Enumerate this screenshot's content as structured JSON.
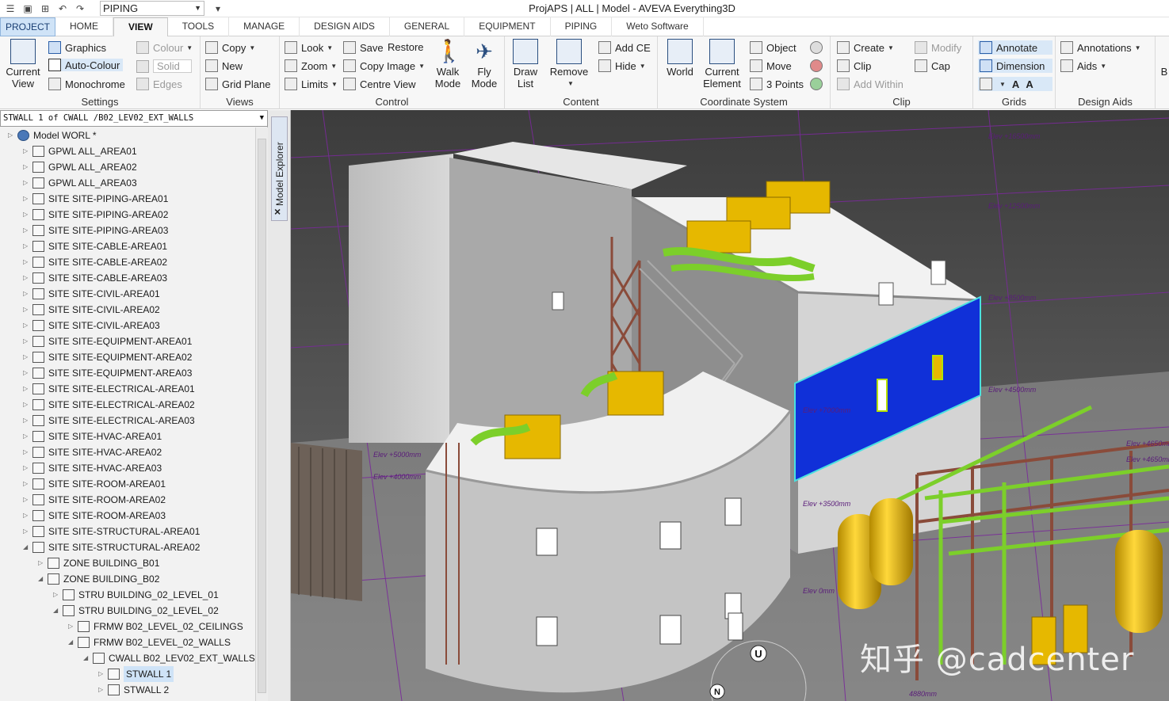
{
  "window": {
    "title": "ProjAPS | ALL | Model - AVEVA Everything3D"
  },
  "quick_access": {
    "module": "PIPING"
  },
  "tabs": [
    {
      "label": "PROJECT"
    },
    {
      "label": "HOME"
    },
    {
      "label": "VIEW"
    },
    {
      "label": "TOOLS"
    },
    {
      "label": "MANAGE"
    },
    {
      "label": "DESIGN AIDS"
    },
    {
      "label": "GENERAL"
    },
    {
      "label": "EQUIPMENT"
    },
    {
      "label": "PIPING"
    },
    {
      "label": "Weto Software"
    }
  ],
  "ribbon": {
    "settings": {
      "label": "Settings",
      "current_view": "Current View",
      "graphics": "Graphics",
      "auto_colour": "Auto-Colour",
      "monochrome": "Monochrome",
      "colour": "Colour",
      "solid": "Solid",
      "edges": "Edges"
    },
    "views": {
      "label": "Views",
      "copy": "Copy",
      "new": "New",
      "grid_plane": "Grid Plane"
    },
    "control": {
      "label": "Control",
      "look": "Look",
      "zoom": "Zoom",
      "limits": "Limits",
      "save": "Save",
      "restore": "Restore",
      "copy_image": "Copy Image",
      "centre_view": "Centre View",
      "walk_mode": "Walk Mode",
      "fly_mode": "Fly Mode"
    },
    "content": {
      "label": "Content",
      "draw_list": "Draw List",
      "remove": "Remove",
      "add_ce": "Add CE",
      "hide": "Hide"
    },
    "coordinate_system": {
      "label": "Coordinate System",
      "world": "World",
      "current_element": "Current Element",
      "object": "Object",
      "move": "Move",
      "three_points": "3 Points"
    },
    "clip": {
      "label": "Clip",
      "create": "Create",
      "clip": "Clip",
      "add_within": "Add Within",
      "modify": "Modify",
      "cap": "Cap"
    },
    "grids": {
      "label": "Grids",
      "annotate": "Annotate",
      "dimension": "Dimension"
    },
    "design_aids": {
      "label": "Design Aids",
      "annotations": "Annotations",
      "aids": "Aids",
      "more": "B"
    }
  },
  "explorer": {
    "breadcrumb": "STWALL 1 of CWALL /B02_LEV02_EXT_WALLS",
    "side_tab_label": "Model Explorer",
    "close_glyph": "×",
    "tree": [
      {
        "label": "Model WORL *",
        "level": 0,
        "icon": "globe-icon"
      },
      {
        "label": "GPWL ALL_AREA01",
        "level": 1,
        "icon": "group-icon"
      },
      {
        "label": "GPWL ALL_AREA02",
        "level": 1,
        "icon": "group-icon"
      },
      {
        "label": "GPWL ALL_AREA03",
        "level": 1,
        "icon": "group-icon"
      },
      {
        "label": "SITE SITE-PIPING-AREA01",
        "level": 1,
        "icon": "site-icon"
      },
      {
        "label": "SITE SITE-PIPING-AREA02",
        "level": 1,
        "icon": "site-icon"
      },
      {
        "label": "SITE SITE-PIPING-AREA03",
        "level": 1,
        "icon": "site-icon"
      },
      {
        "label": "SITE SITE-CABLE-AREA01",
        "level": 1,
        "icon": "site-icon"
      },
      {
        "label": "SITE SITE-CABLE-AREA02",
        "level": 1,
        "icon": "site-icon"
      },
      {
        "label": "SITE SITE-CABLE-AREA03",
        "level": 1,
        "icon": "site-icon"
      },
      {
        "label": "SITE SITE-CIVIL-AREA01",
        "level": 1,
        "icon": "site-icon"
      },
      {
        "label": "SITE SITE-CIVIL-AREA02",
        "level": 1,
        "icon": "site-icon"
      },
      {
        "label": "SITE SITE-CIVIL-AREA03",
        "level": 1,
        "icon": "site-icon"
      },
      {
        "label": "SITE SITE-EQUIPMENT-AREA01",
        "level": 1,
        "icon": "site-icon"
      },
      {
        "label": "SITE SITE-EQUIPMENT-AREA02",
        "level": 1,
        "icon": "site-icon"
      },
      {
        "label": "SITE SITE-EQUIPMENT-AREA03",
        "level": 1,
        "icon": "site-icon"
      },
      {
        "label": "SITE SITE-ELECTRICAL-AREA01",
        "level": 1,
        "icon": "site-icon"
      },
      {
        "label": "SITE SITE-ELECTRICAL-AREA02",
        "level": 1,
        "icon": "site-icon"
      },
      {
        "label": "SITE SITE-ELECTRICAL-AREA03",
        "level": 1,
        "icon": "site-icon"
      },
      {
        "label": "SITE SITE-HVAC-AREA01",
        "level": 1,
        "icon": "site-icon"
      },
      {
        "label": "SITE SITE-HVAC-AREA02",
        "level": 1,
        "icon": "site-icon"
      },
      {
        "label": "SITE SITE-HVAC-AREA03",
        "level": 1,
        "icon": "site-icon"
      },
      {
        "label": "SITE SITE-ROOM-AREA01",
        "level": 1,
        "icon": "site-icon"
      },
      {
        "label": "SITE SITE-ROOM-AREA02",
        "level": 1,
        "icon": "site-icon"
      },
      {
        "label": "SITE SITE-ROOM-AREA03",
        "level": 1,
        "icon": "site-icon"
      },
      {
        "label": "SITE SITE-STRUCTURAL-AREA01",
        "level": 1,
        "icon": "site-icon"
      },
      {
        "label": "SITE SITE-STRUCTURAL-AREA02",
        "level": 1,
        "icon": "site-icon",
        "expanded": true
      },
      {
        "label": "ZONE BUILDING_B01",
        "level": 2,
        "icon": "zone-icon"
      },
      {
        "label": "ZONE BUILDING_B02",
        "level": 2,
        "icon": "zone-icon",
        "expanded": true
      },
      {
        "label": "STRU BUILDING_02_LEVEL_01",
        "level": 3,
        "icon": "structure-icon"
      },
      {
        "label": "STRU BUILDING_02_LEVEL_02",
        "level": 3,
        "icon": "structure-icon",
        "expanded": true
      },
      {
        "label": "FRMW B02_LEVEL_02_CEILINGS",
        "level": 4,
        "icon": "framework-icon"
      },
      {
        "label": "FRMW B02_LEVEL_02_WALLS",
        "level": 4,
        "icon": "framework-icon",
        "expanded": true
      },
      {
        "label": "CWALL B02_LEV02_EXT_WALLS",
        "level": 5,
        "icon": "compound-wall-icon",
        "expanded": true
      },
      {
        "label": "STWALL 1",
        "level": 6,
        "icon": "wall-icon",
        "selected": true
      },
      {
        "label": "STWALL 2",
        "level": 6,
        "icon": "wall-icon"
      }
    ]
  },
  "viewport": {
    "elevation_labels": [
      "Elev +16500mm",
      "Elev +12500mm",
      "Elev +8500mm",
      "Elev +4500mm",
      "Elev +4650mm",
      "Elev +7000mm",
      "Elev +5000mm",
      "Elev +4000mm",
      "Elev +3500mm",
      "Elev 0mm",
      "Elev +4650mm",
      "4880mm"
    ],
    "compass_up": "U",
    "compass_north": "N",
    "watermark": "知乎 @cadcenter"
  },
  "colors": {
    "selected_wall": "#1030d8",
    "equipment": "#e6b800",
    "piping": "#7ccf2a",
    "steel": "#8a4b3a",
    "grid_lines": "#7a2a9a",
    "background_dark": "#4a4a4a"
  }
}
